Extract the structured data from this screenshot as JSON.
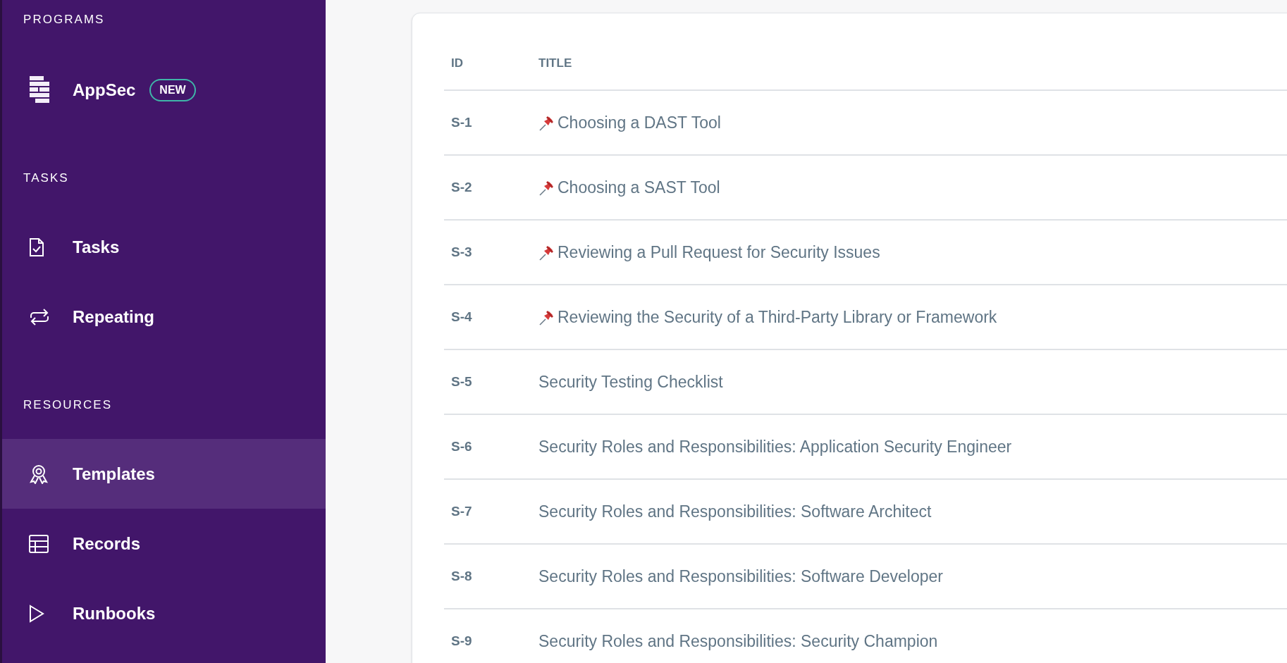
{
  "sidebar": {
    "sections": [
      {
        "title": "PROGRAMS",
        "items": [
          {
            "label": "AppSec",
            "badge": "NEW",
            "selected": false
          }
        ]
      },
      {
        "title": "TASKS",
        "items": [
          {
            "label": "Tasks",
            "selected": false
          },
          {
            "label": "Repeating",
            "selected": false
          }
        ]
      },
      {
        "title": "RESOURCES",
        "items": [
          {
            "label": "Templates",
            "selected": true
          },
          {
            "label": "Records",
            "selected": false
          },
          {
            "label": "Runbooks",
            "selected": false
          }
        ]
      }
    ]
  },
  "table": {
    "columns": [
      "ID",
      "TITLE"
    ],
    "rows": [
      {
        "id": "S-1",
        "title": "Choosing a DAST Tool",
        "pinned": true
      },
      {
        "id": "S-2",
        "title": "Choosing a SAST Tool",
        "pinned": true
      },
      {
        "id": "S-3",
        "title": "Reviewing a Pull Request for Security Issues",
        "pinned": true
      },
      {
        "id": "S-4",
        "title": "Reviewing the Security of a Third-Party Library or Framework",
        "pinned": true
      },
      {
        "id": "S-5",
        "title": "Security Testing Checklist",
        "pinned": false
      },
      {
        "id": "S-6",
        "title": "Security Roles and Responsibilities: Application Security Engineer",
        "pinned": false
      },
      {
        "id": "S-7",
        "title": "Security Roles and Responsibilities: Software Architect",
        "pinned": false
      },
      {
        "id": "S-8",
        "title": "Security Roles and Responsibilities: Software Developer",
        "pinned": false
      },
      {
        "id": "S-9",
        "title": "Security Roles and Responsibilities: Security Champion",
        "pinned": false
      }
    ]
  }
}
